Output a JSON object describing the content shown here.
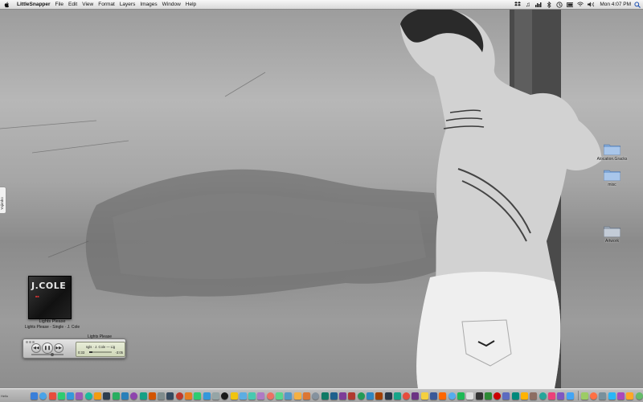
{
  "menubar": {
    "app_name": "LittleSnapper",
    "menus": [
      "File",
      "Edit",
      "View",
      "Format",
      "Layers",
      "Images",
      "Window",
      "Help"
    ],
    "extras_icons": [
      "dropbox-icon",
      "music-note-icon",
      "activity-icon",
      "bluetooth-icon",
      "timemachine-icon",
      "battery-icon",
      "wifi-icon",
      "volume-icon"
    ],
    "clock": "Mon 4:07 PM",
    "spotlight_icon": "spotlight-icon",
    "apple_icon": "apple-icon"
  },
  "desktop_icons": [
    {
      "label": "Alocation.Gracks",
      "icon": "folder-icon"
    },
    {
      "label": "misc",
      "icon": "folder-icon"
    },
    {
      "label": "Artwork",
      "icon": "folder-icon"
    }
  ],
  "album_widget": {
    "cover_title": "J.COLE",
    "track": "Lights Please",
    "detail": "Lights Please - Single · J. Cole"
  },
  "mini_player": {
    "title": "Lights Please",
    "line1": "ngls · J. Cole — Lig",
    "elapsed": "0:33",
    "remaining": "-3:05",
    "progress": 0.15,
    "volume": 0.6,
    "buttons": [
      "previous-icon",
      "pause-icon",
      "next-icon"
    ]
  },
  "edge_tab": {
    "label": "Yojimbo"
  },
  "dock": {
    "items": [
      "#3a7fd9",
      "#4aa3e8",
      "#e74c3c",
      "#2ecc71",
      "#3498db",
      "#9b59b6",
      "#1abc9c",
      "#f39c12",
      "#2c3e50",
      "#27ae60",
      "#2980b9",
      "#8e44ad",
      "#16a085",
      "#d35400",
      "#7f8c8d",
      "#34495e",
      "#c0392b",
      "#e67e22",
      "#2ecc71",
      "#3498db",
      "#95a5a6",
      "#1a1a1a",
      "#f1c40f",
      "#5dade2",
      "#48c9b0",
      "#af7ac5",
      "#ec7063",
      "#58d68d",
      "#5499c7",
      "#f5b041",
      "#dc7633",
      "#85929e",
      "#117a65",
      "#1f618d",
      "#7d3c98",
      "#b03a2e",
      "#239b56",
      "#2e86c1",
      "#a04000",
      "#283747",
      "#17a589",
      "#e74c3c",
      "#6c3483",
      "#f4d03f",
      "#3b5998",
      "#ff6600",
      "#55acee",
      "#1db954",
      "#e0e0e0",
      "#333333",
      "#2d8a35",
      "#cc0000",
      "#5c6bc0",
      "#00897b",
      "#ffb300",
      "#8d6e63",
      "#26a69a",
      "#ec407a",
      "#7e57c2",
      "#42a5f5",
      "#9ccc65",
      "#ff7043",
      "#78909c",
      "#29b6f6",
      "#ab47bc",
      "#ffa726",
      "#66bb6a",
      "#5c5c5c",
      "#a1887f"
    ]
  },
  "corner_label": "Hello"
}
